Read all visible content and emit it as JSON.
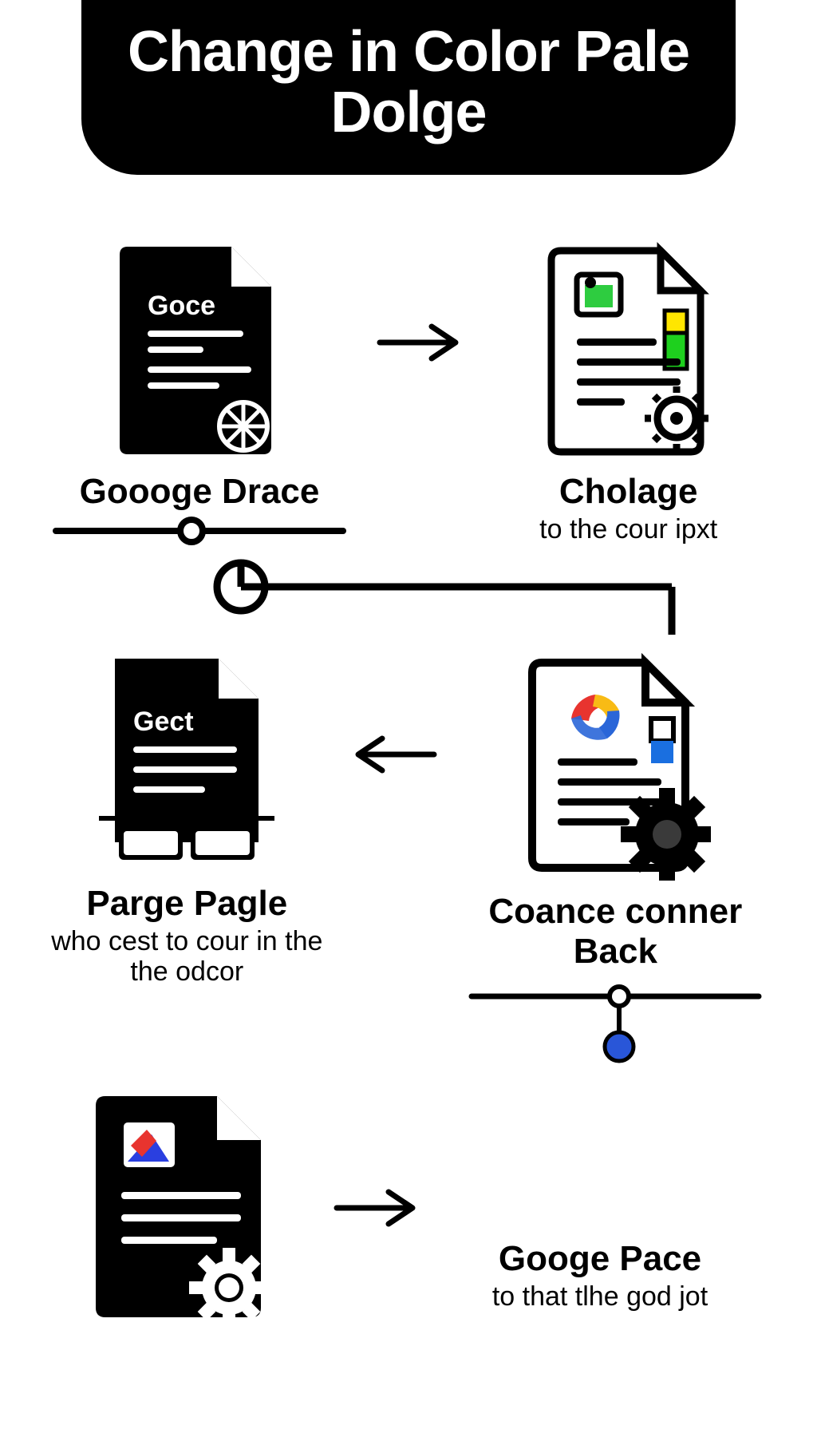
{
  "banner": {
    "line1": "Change in Color Pale",
    "line2": "Dolge"
  },
  "steps": {
    "s1": {
      "title": "Goooge Drace",
      "doclabel": "Goce"
    },
    "s2": {
      "title": "Cholage",
      "sub": "to the cour ipxt"
    },
    "s3": {
      "title": "Parge Pagle",
      "sub": "who cest to cour in the the odcor",
      "doclabel": "Gect"
    },
    "s4": {
      "title": "Coance conner Back"
    },
    "s5": {
      "title": "Googe Pace",
      "sub": "to that tlhe god jot"
    }
  }
}
